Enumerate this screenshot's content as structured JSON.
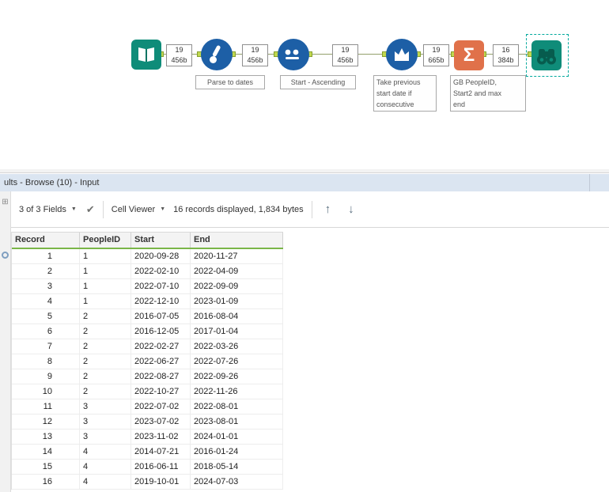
{
  "canvas": {
    "connection_labels": [
      {
        "records": "19",
        "size": "456b"
      },
      {
        "records": "19",
        "size": "456b"
      },
      {
        "records": "19",
        "size": "456b"
      },
      {
        "records": "19",
        "size": "665b"
      },
      {
        "records": "16",
        "size": "384b"
      }
    ],
    "annotations": {
      "formula": "Parse to dates",
      "sort": "Start - Ascending",
      "multirow": "Take previous\nstart date if\nconsecutive",
      "summarize": "GB PeopleID,\nStart2 and max\nend"
    },
    "colors": {
      "teal": "#0f8c79",
      "blue": "#1d5fa6",
      "orange": "#e0714a",
      "anchor": "#c0d84f",
      "selection": "#00a99d"
    }
  },
  "icons": {
    "sigma": "Σ",
    "check": "✔",
    "caret": "▼",
    "up_arrow": "↑",
    "down_arrow": "↓",
    "grid": "⊞"
  },
  "results": {
    "title": "ults - Browse (10) - Input",
    "toolbar": {
      "fields": "3 of 3 Fields",
      "cell_viewer": "Cell Viewer",
      "status": "16 records displayed, 1,834 bytes"
    },
    "table": {
      "columns": [
        "Record",
        "PeopleID",
        "Start",
        "End"
      ],
      "rows": [
        [
          "1",
          "1",
          "2020-09-28",
          "2020-11-27"
        ],
        [
          "2",
          "1",
          "2022-02-10",
          "2022-04-09"
        ],
        [
          "3",
          "1",
          "2022-07-10",
          "2022-09-09"
        ],
        [
          "4",
          "1",
          "2022-12-10",
          "2023-01-09"
        ],
        [
          "5",
          "2",
          "2016-07-05",
          "2016-08-04"
        ],
        [
          "6",
          "2",
          "2016-12-05",
          "2017-01-04"
        ],
        [
          "7",
          "2",
          "2022-02-27",
          "2022-03-26"
        ],
        [
          "8",
          "2",
          "2022-06-27",
          "2022-07-26"
        ],
        [
          "9",
          "2",
          "2022-08-27",
          "2022-09-26"
        ],
        [
          "10",
          "2",
          "2022-10-27",
          "2022-11-26"
        ],
        [
          "11",
          "3",
          "2022-07-02",
          "2022-08-01"
        ],
        [
          "12",
          "3",
          "2023-07-02",
          "2023-08-01"
        ],
        [
          "13",
          "3",
          "2023-11-02",
          "2024-01-01"
        ],
        [
          "14",
          "4",
          "2014-07-21",
          "2016-01-24"
        ],
        [
          "15",
          "4",
          "2016-06-11",
          "2018-05-14"
        ],
        [
          "16",
          "4",
          "2019-10-01",
          "2024-07-03"
        ]
      ]
    }
  }
}
